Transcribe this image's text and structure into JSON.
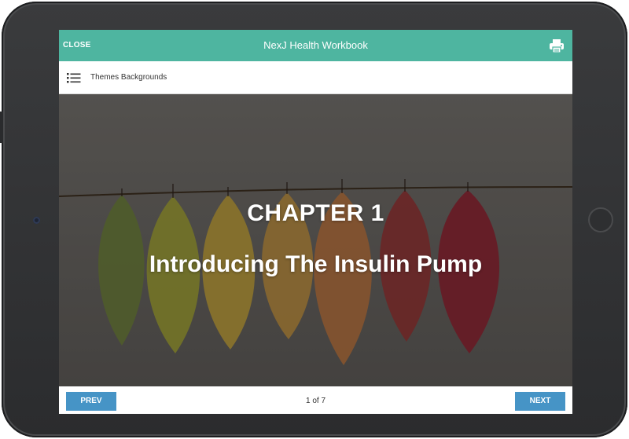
{
  "app": {
    "title": "NexJ Health Workbook",
    "close_label": "CLOSE",
    "print_icon": "printer-icon",
    "accent_color": "#4eb5a0"
  },
  "toolbar": {
    "menu_icon": "list-menu-icon",
    "theme_label": "Themes Backgrounds"
  },
  "content": {
    "chapter": "CHAPTER 1",
    "title": "Introducing The Insulin Pump",
    "background_image": "autumn leaves hanging on a string"
  },
  "footer": {
    "prev_label": "PREV",
    "next_label": "NEXT",
    "page_indicator": "1 of 7",
    "button_color": "#4694c6"
  }
}
